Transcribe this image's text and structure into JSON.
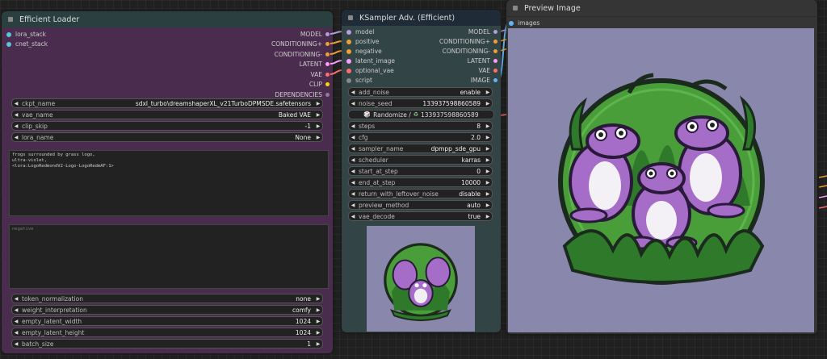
{
  "loader": {
    "title": "Efficient Loader",
    "inputs": [
      "lora_stack",
      "cnet_stack"
    ],
    "outputs": [
      "MODEL",
      "CONDITIONING+",
      "CONDITIONING-",
      "LATENT",
      "VAE",
      "CLIP",
      "DEPENDENCIES"
    ],
    "widgets_top": [
      {
        "label": "ckpt_name",
        "value": "sdxl_turbo\\dreamshaperXL_v21TurboDPMSDE.safetensors"
      },
      {
        "label": "vae_name",
        "value": "Baked VAE"
      },
      {
        "label": "clip_skip",
        "value": "-1"
      },
      {
        "label": "lora_name",
        "value": "None"
      }
    ],
    "positive_prompt": "frogs surrounded by grass logo,\nultra-violet,\n<lora:LogoRedmondV2-Logo-LogoRedmAF:1>",
    "negative_placeholder": "negative",
    "widgets_bottom": [
      {
        "label": "token_normalization",
        "value": "none"
      },
      {
        "label": "weight_interpretation",
        "value": "comfy"
      },
      {
        "label": "empty_latent_width",
        "value": "1024"
      },
      {
        "label": "empty_latent_height",
        "value": "1024"
      },
      {
        "label": "batch_size",
        "value": "1"
      }
    ]
  },
  "ksampler": {
    "title": "KSampler Adv. (Efficient)",
    "rows": [
      {
        "in": "model",
        "out": "MODEL"
      },
      {
        "in": "positive",
        "out": "CONDITIONING+"
      },
      {
        "in": "negative",
        "out": "CONDITIONING-"
      },
      {
        "in": "latent_image",
        "out": "LATENT"
      },
      {
        "in": "optional_vae",
        "out": "VAE"
      },
      {
        "in": "script",
        "out": "IMAGE"
      }
    ],
    "widgets_a": [
      {
        "label": "add_noise",
        "value": "enable"
      },
      {
        "label": "noise_seed",
        "value": "133937598860589"
      }
    ],
    "randomize_label": "Randomize /",
    "randomize_value": "133937598860589",
    "widgets_b": [
      {
        "label": "steps",
        "value": "8"
      },
      {
        "label": "cfg",
        "value": "2.0"
      },
      {
        "label": "sampler_name",
        "value": "dpmpp_sde_gpu"
      },
      {
        "label": "scheduler",
        "value": "karras"
      },
      {
        "label": "start_at_step",
        "value": "0"
      },
      {
        "label": "end_at_step",
        "value": "10000"
      },
      {
        "label": "return_with_leftover_noise",
        "value": "disable"
      },
      {
        "label": "preview_method",
        "value": "auto"
      },
      {
        "label": "vae_decode",
        "value": "true"
      }
    ]
  },
  "preview": {
    "title": "Preview Image",
    "input": "images"
  },
  "colors": {
    "loader_body": "#4a2d4e",
    "loader_title": "#2a3f3f",
    "ksampler_body": "#324445",
    "ksampler_title": "#1f2b36",
    "preview_body": "#353535",
    "image_bg": "#8a87ad",
    "frog": "#a56cc8",
    "grass": "#4a9e3a"
  }
}
